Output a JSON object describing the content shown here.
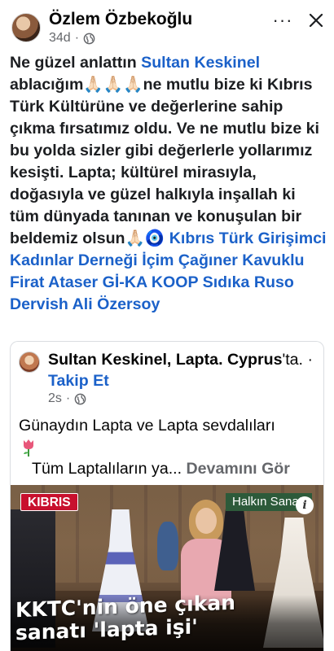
{
  "post": {
    "author": "Özlem Özbekoğlu",
    "time": "34d",
    "privacy_icon": "globe-icon",
    "text_segments": [
      {
        "text": "Ne güzel anlattın ",
        "type": "text"
      },
      {
        "text": "Sultan Keskinel",
        "type": "link"
      },
      {
        "text": " ablacığım🙏🏻🙏🏻🙏🏻ne mutlu bize ki Kıbrıs Türk Kültürüne ve değerlerine sahip çıkma fırsatımız oldu. Ve ne mutlu bize ki bu yolda sizler gibi değerlerle yollarımız kesişti. Lapta; kültürel mirasıyla, doğasıyla ve güzel halkıyla inşallah ki tüm dünyada tanınan ve konuşulan bir beldemiz olsun🙏🏻🧿 ",
        "type": "text"
      },
      {
        "text": "Kıbrıs Türk Girişimci Kadınlar Derneği",
        "type": "link"
      },
      {
        "text": " ",
        "type": "text"
      },
      {
        "text": "İçim Çağıner Kavuklu",
        "type": "link"
      },
      {
        "text": " ",
        "type": "text"
      },
      {
        "text": "Firat Ataser",
        "type": "link"
      },
      {
        "text": " ",
        "type": "text"
      },
      {
        "text": "Gİ-KA KOOP",
        "type": "link"
      },
      {
        "text": " ",
        "type": "text"
      },
      {
        "text": "Sıdıka Ruso Dervish",
        "type": "link"
      },
      {
        "text": " ",
        "type": "text"
      },
      {
        "text": "Ali Özersoy",
        "type": "link"
      }
    ]
  },
  "header_actions": {
    "more_label": "···",
    "more_icon": "more-horizontal-icon",
    "close_icon": "close-icon"
  },
  "shared": {
    "author": "Sultan Keskinel",
    "location_prefix": ", ",
    "location": "Lapta. Cyprus",
    "location_suffix": "'ta.",
    "separator": " · ",
    "follow_label": "Takip Et",
    "time": "2s",
    "privacy_icon": "globe-icon",
    "line1": "Günaydın Lapta ve Lapta sevdalıları",
    "emoji_icon": "tulip-icon",
    "line2": "Tüm Laptalıların ya...",
    "see_more": "Devamını Gör",
    "video": {
      "badge_left": "KIBRIS",
      "badge_right": "Halkın Sanatı",
      "info_label": "i",
      "caption": "KKTC'nin öne çıkan sanatı 'lapta işi'"
    }
  },
  "colors": {
    "link": "#1b61c9",
    "secondary_text": "#65676b",
    "badge_red": "#c8102e",
    "badge_green": "#2d5a3a"
  }
}
